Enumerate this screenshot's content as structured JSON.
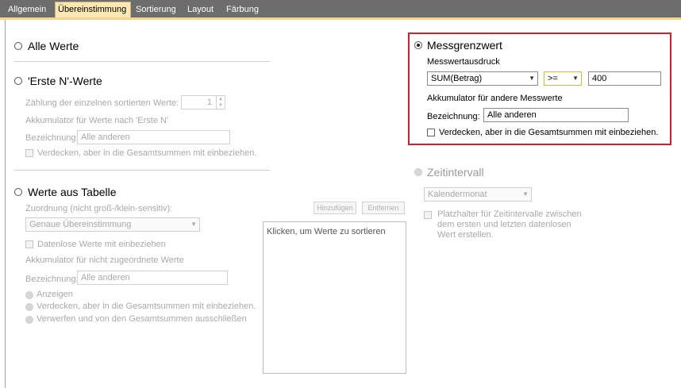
{
  "tabs": [
    {
      "label": "Allgemein",
      "active": false
    },
    {
      "label": "Übereinstimmung",
      "active": true
    },
    {
      "label": "Sortierung",
      "active": false
    },
    {
      "label": "Layout",
      "active": false
    },
    {
      "label": "Färbung",
      "active": false
    }
  ],
  "alle_werte": {
    "label": "Alle Werte"
  },
  "erste_n": {
    "label": "'Erste N'-Werte",
    "count_label": "Zählung der einzelnen sortierten Werte:",
    "count_value": "1",
    "akkumulator_label": "Akkumulator für Werte nach 'Erste N'",
    "bezeichnung_label": "Bezeichnung:",
    "bezeichnung_value": "Alle anderen",
    "verdecken_label": "Verdecken, aber in die Gesamtsummen mit einbeziehen."
  },
  "tabelle": {
    "label": "Werte aus Tabelle",
    "zuordnung_label": "Zuordnung (nicht groß-/klein-sensitiv):",
    "zuordnung_value": "Genaue Übereinstimmung",
    "hinzufuegen_label": "Hinzufügen",
    "entfernen_label": "Entfernen",
    "list_header": "Klicken, um Werte zu sortieren",
    "datenlose_label": "Datenlose Werte mit einbeziehen",
    "akkumulator_label": "Akkumulator für nicht zugeordnete Werte",
    "bezeichnung_label": "Bezeichnung:",
    "bezeichnung_value": "Alle anderen",
    "options": [
      "Anzeigen",
      "Verdecken, aber in die Gesamtsummen mit einbeziehen.",
      "Verwerfen und von den Gesamtsummen ausschließen"
    ]
  },
  "messgrenzwert": {
    "label": "Messgrenzwert",
    "ausdruck_label": "Messwertausdruck",
    "ausdruck_value": "SUM(Betrag)",
    "operator_value": ">=",
    "threshold_value": "400",
    "akkumulator_label": "Akkumulator für andere Messwerte",
    "bezeichnung_label": "Bezeichnung:",
    "bezeichnung_value": "Alle anderen",
    "verdecken_label": "Verdecken, aber in die Gesamtsummen mit einbeziehen."
  },
  "zeitintervall": {
    "label": "Zeitintervall",
    "select_value": "Kalendermonat",
    "platzhalter_label_1": "Platzhalter für Zeitintervalle zwischen",
    "platzhalter_label_2": "dem ersten und letzten datenlosen",
    "platzhalter_label_3": "Wert erstellen."
  },
  "colors": {
    "tabbar": "#6d6d6d",
    "active_tab": "#fbe7b1",
    "highlight_border": "#d5202a",
    "operator_border": "#e8b630"
  },
  "icons": [
    "dropdown-arrow-icon",
    "spinner-up-icon",
    "spinner-down-icon"
  ]
}
